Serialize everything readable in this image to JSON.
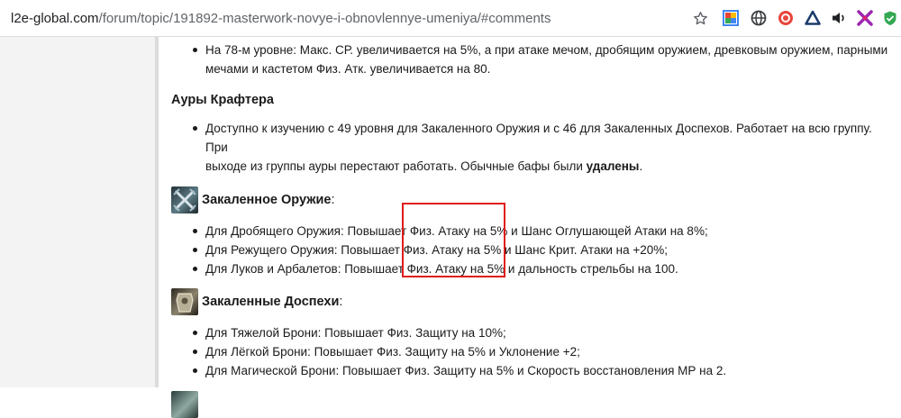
{
  "browser": {
    "url_domain": "l2e-global.com",
    "url_path": "/forum/topic/191892-masterwork-novye-i-obnovlennye-umeniya/#comments",
    "extensions": [
      "star-icon",
      "google-keep-icon",
      "globe-icon",
      "record-icon",
      "delta-icon",
      "speaker-icon",
      "x-extension-icon",
      "shield-check-icon"
    ]
  },
  "article": {
    "line_78": "На 78-м уровне: Макс. СР. увеличивается на 5%, а при атаке мечом, дробящим оружием, древковым оружием, парными",
    "line_78_cont": "мечами и кастетом Физ. Атк. увеличивается на 80.",
    "crafter_heading": "Ауры Крафтера",
    "crafter_desc_1": "Доступно к изучению с 49 уровня для Закаленного Оружия и с 46 для Закаленных Доспехов. Работает на всю группу. При",
    "crafter_desc_2a": "выходе из группы ауры перестают работать. Обычные бафы были ",
    "crafter_desc_2b": "удалены",
    "crafter_desc_2c": ".",
    "weapon_title": "Закаленное Оружие",
    "weapon_colon": ":",
    "weapon_items": [
      "Для Дробящего Оружия: Повышает Физ. Атаку на 5% и Шанс Оглушающей Атаки на 8%;",
      "Для Режущего Оружия: Повышает Физ. Атаку на 5% и Шанс Крит. Атаки на +20%;",
      "Для Луков и Арбалетов: Повышает Физ. Атаку на 5% и дальность стрельбы на 100."
    ],
    "armor_title": "Закаленные Доспехи",
    "armor_colon": ":",
    "armor_items": [
      "Для Тяжелой Брони: Повышает Физ. Защиту на 10%;",
      "Для Лёгкой Брони: Повышает Физ. Защиту на 5% и Уклонение +2;",
      "Для Магической Брони: Повышает Физ. Защиту на 5% и Скорость восстановления МР на 2."
    ]
  }
}
